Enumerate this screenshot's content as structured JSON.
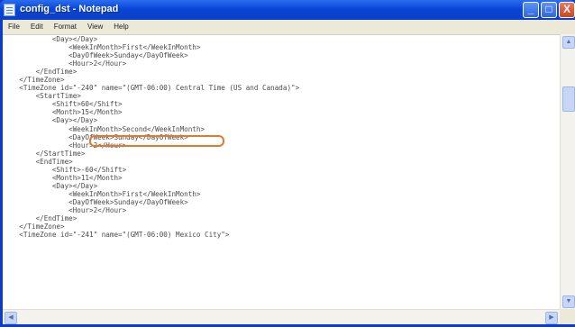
{
  "window": {
    "title": "config_dst - Notepad",
    "controls": {
      "minimize": "_",
      "maximize": "□",
      "close": "X"
    }
  },
  "menu": [
    "File",
    "Edit",
    "Format",
    "View",
    "Help"
  ],
  "document": {
    "lines": [
      "            <Day></Day>",
      "                <WeekInMonth>First</WeekInMonth>",
      "                <DayOfWeek>Sunday</DayOfWeek>",
      "                <Hour>2</Hour>",
      "        </EndTime>",
      "    </TimeZone>",
      "    <TimeZone id=\"-240\" name=\"(GMT-06:00) Central Time (US and Canada)\">",
      "        <StartTime>",
      "            <Shift>60</Shift>",
      "            <Month>15</Month>",
      "            <Day></Day>",
      "                <WeekInMonth>Second</WeekInMonth>",
      "                <DayOfWeek>Sunday</DayOfWeek>",
      "                <Hour>2</Hour>",
      "        </StartTime>",
      "        <EndTime>",
      "            <Shift>-60</Shift>",
      "            <Month>11</Month>",
      "            <Day></Day>",
      "                <WeekInMonth>First</WeekInMonth>",
      "                <DayOfWeek>Sunday</DayOfWeek>",
      "                <Hour>2</Hour>",
      "        </EndTime>",
      "    </TimeZone>",
      "    <TimeZone id=\"-241\" name=\"(GMT-06:00) Mexico City\">"
    ]
  },
  "annotation": {
    "color": "#e07a2c"
  },
  "colors": {
    "titlebar": "#0a45d6",
    "menubar": "#ece9d8",
    "text": "#4a4a4a"
  }
}
